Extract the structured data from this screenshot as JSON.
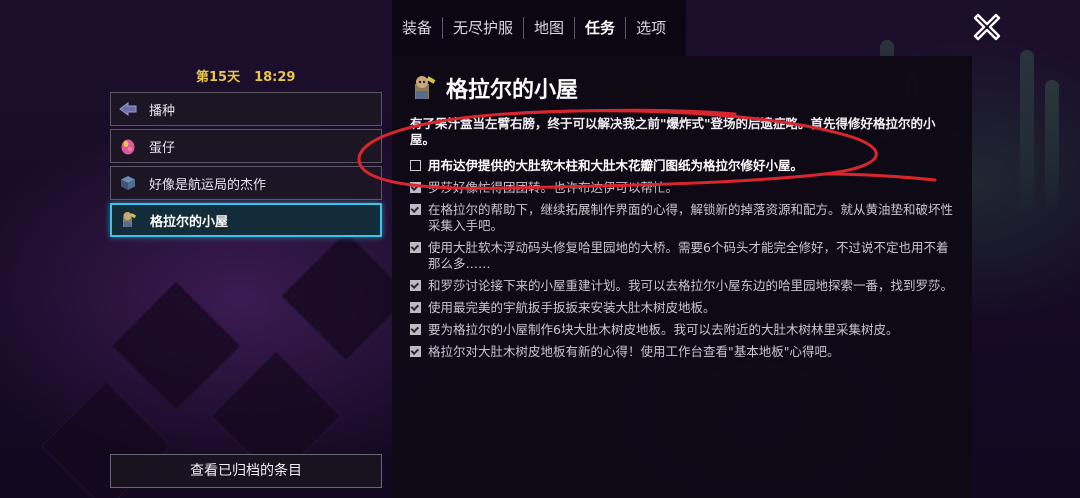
{
  "nav": {
    "tabs": [
      {
        "label": "装备"
      },
      {
        "label": "无尽护服"
      },
      {
        "label": "地图"
      },
      {
        "label": "任务",
        "active": true
      },
      {
        "label": "选项"
      }
    ],
    "close_icon": "close-x-icon"
  },
  "sidebar": {
    "day": "第15天",
    "time": "18:29",
    "quests": [
      {
        "label": "播种",
        "icon": "seed-icon"
      },
      {
        "label": "蛋仔",
        "icon": "egg-icon"
      },
      {
        "label": "好像是航运局的杰作",
        "icon": "cube-icon"
      },
      {
        "label": "格拉尔的小屋",
        "icon": "gral-portrait-icon",
        "active": true
      }
    ],
    "archive_button": "查看已归档的条目"
  },
  "detail": {
    "title": "格拉尔的小屋",
    "title_icon": "gral-portrait-icon",
    "description": "有了果汁盒当左臂右膀，终于可以解决我之前\"爆炸式\"登场的后遗症略。首先得修好格拉尔的小屋。",
    "steps": [
      {
        "text": "用布达伊提供的大肚软木柱和大肚木花瓣门图纸为格拉尔修好小屋。",
        "checked": false
      },
      {
        "text": "罗莎好像忙得团团转。也许布达伊可以帮忙。",
        "checked": true
      },
      {
        "text": "在格拉尔的帮助下，继续拓展制作界面的心得，解锁新的掉落资源和配方。就从黄油垫和破坏性采集入手吧。",
        "checked": true
      },
      {
        "text": "使用大肚软木浮动码头修复哈里园地的大桥。需要6个码头才能完全修好，不过说不定也用不着那么多……",
        "checked": true
      },
      {
        "text": "和罗莎讨论接下来的小屋重建计划。我可以去格拉尔小屋东边的哈里园地探索一番，找到罗莎。",
        "checked": true
      },
      {
        "text": "使用最完美的宇航扳手扳扳来安装大肚木树皮地板。",
        "checked": true
      },
      {
        "text": "要为格拉尔的小屋制作6块大肚木树皮地板。我可以去附近的大肚木树林里采集树皮。",
        "checked": true
      },
      {
        "text": "格拉尔对大肚木树皮地板有新的心得！使用工作台查看\"基本地板\"心得吧。",
        "checked": true
      }
    ]
  },
  "annotation": {
    "type": "red-freehand-circle",
    "color": "#d8262e"
  }
}
